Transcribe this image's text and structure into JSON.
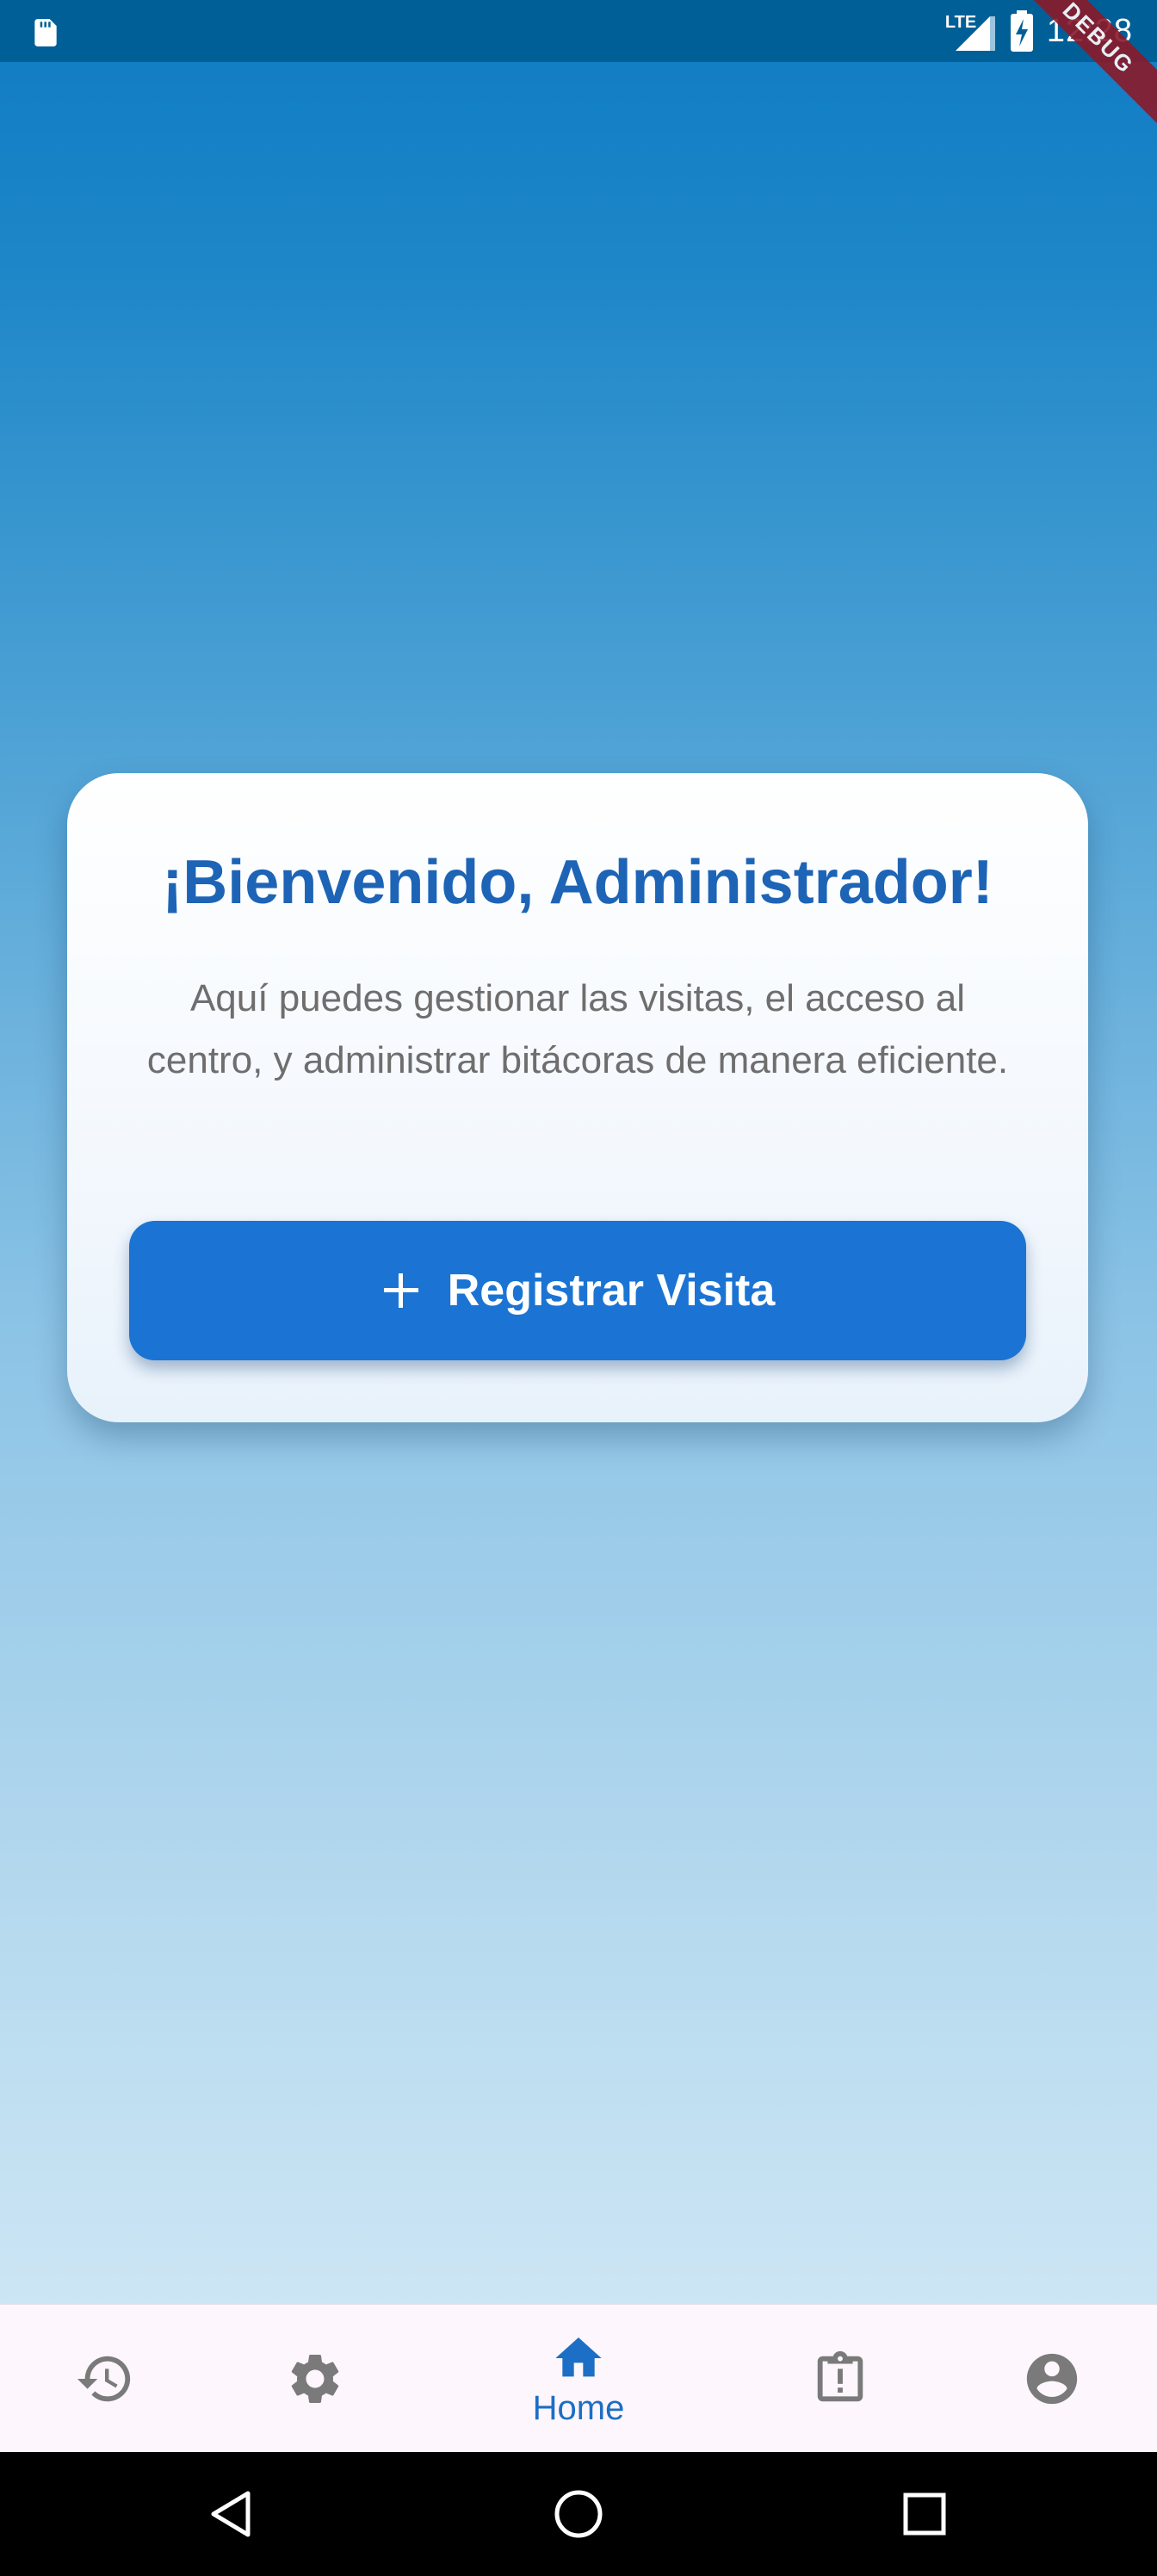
{
  "status_bar": {
    "time": "12:28",
    "network": "LTE",
    "debug_banner": "DEBUG"
  },
  "card": {
    "title": "¡Bienvenido, Administrador!",
    "description": "Aquí puedes gestionar las visitas, el acceso al centro, y administrar bitácoras de manera eficiente.",
    "button_label": "Registrar Visita",
    "button_icon": "plus-icon"
  },
  "bottom_nav": {
    "items": [
      {
        "id": "history",
        "icon": "history-icon",
        "label": "",
        "active": false
      },
      {
        "id": "settings",
        "icon": "gear-icon",
        "label": "",
        "active": false
      },
      {
        "id": "home",
        "icon": "home-icon",
        "label": "Home",
        "active": true
      },
      {
        "id": "reports",
        "icon": "clipboard-alert-icon",
        "label": "",
        "active": false
      },
      {
        "id": "profile",
        "icon": "account-circle-icon",
        "label": "",
        "active": false
      }
    ]
  },
  "colors": {
    "status_bar_bg": "#015f97",
    "gradient_top": "#0f7bc3",
    "gradient_bottom": "#dbeef8",
    "primary": "#1b74d3",
    "title": "#1d64b6",
    "nav_inactive": "#7a7a7a",
    "nav_active": "#1c6fc4"
  }
}
